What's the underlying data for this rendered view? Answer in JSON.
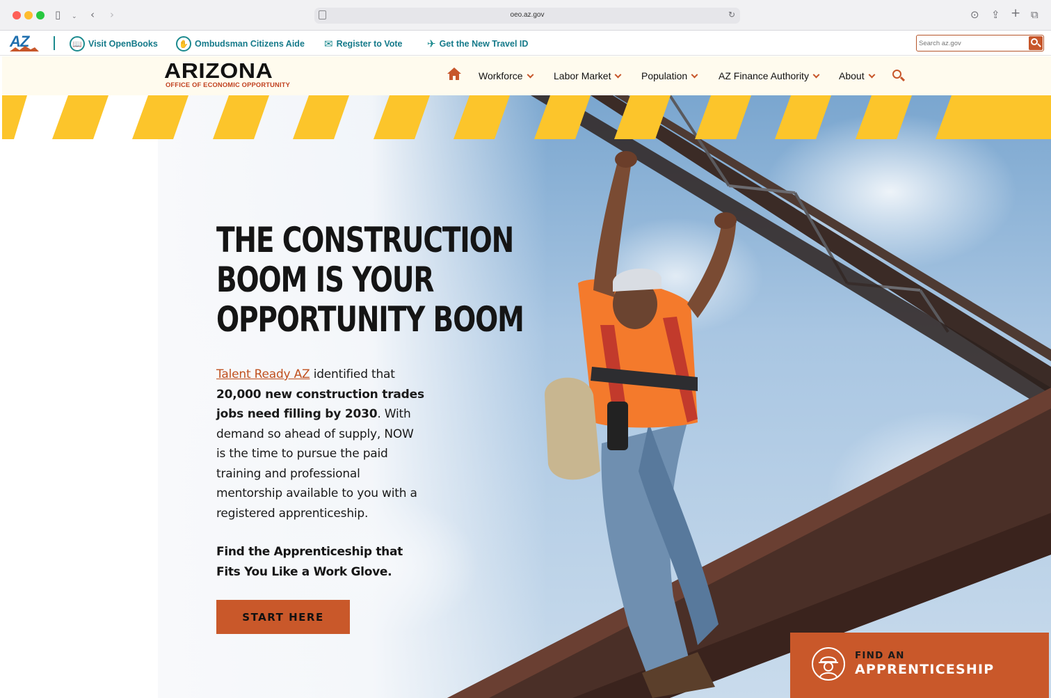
{
  "browser": {
    "url": "oeo.az.gov"
  },
  "utility_bar": {
    "logo_text": "AZ",
    "links": [
      {
        "label": "Visit OpenBooks",
        "icon": "book-icon"
      },
      {
        "label": "Ombudsman Citizens Aide",
        "icon": "hand-icon"
      },
      {
        "label": "Register to Vote",
        "icon": "ballot-icon"
      },
      {
        "label": "Get the New Travel ID",
        "icon": "plane-icon"
      }
    ],
    "search_placeholder": "Search az.gov"
  },
  "header": {
    "brand_name": "ARIZONA",
    "brand_subtitle": "OFFICE OF ECONOMIC OPPORTUNITY",
    "nav": [
      {
        "label": "Workforce"
      },
      {
        "label": "Labor Market"
      },
      {
        "label": "Population"
      },
      {
        "label": "AZ Finance Authority"
      },
      {
        "label": "About"
      }
    ]
  },
  "hero": {
    "headline": [
      "THE CONSTRUCTION",
      "BOOM IS YOUR",
      "OPPORTUNITY BOOM"
    ],
    "link_text": "Talent Ready AZ",
    "text_after_link": " identified that",
    "bold_statement": "20,000 new construction trades jobs need filling by 2030",
    "period": ".",
    "body_rest": "With demand so ahead of supply, NOW is the time to pursue the paid training and professional mentorship available to you with a registered apprenticeship.",
    "cta_text": "Find the Apprenticeship that Fits You Like a Work Glove.",
    "button_label": "START HERE"
  },
  "find_card": {
    "line1": "FIND AN",
    "line2": "APPRENTICESHIP"
  },
  "colors": {
    "accent_orange": "#c9582a",
    "stripe_yellow": "#fcc52b",
    "teal": "#157a8a",
    "header_bg": "#fffbee"
  }
}
